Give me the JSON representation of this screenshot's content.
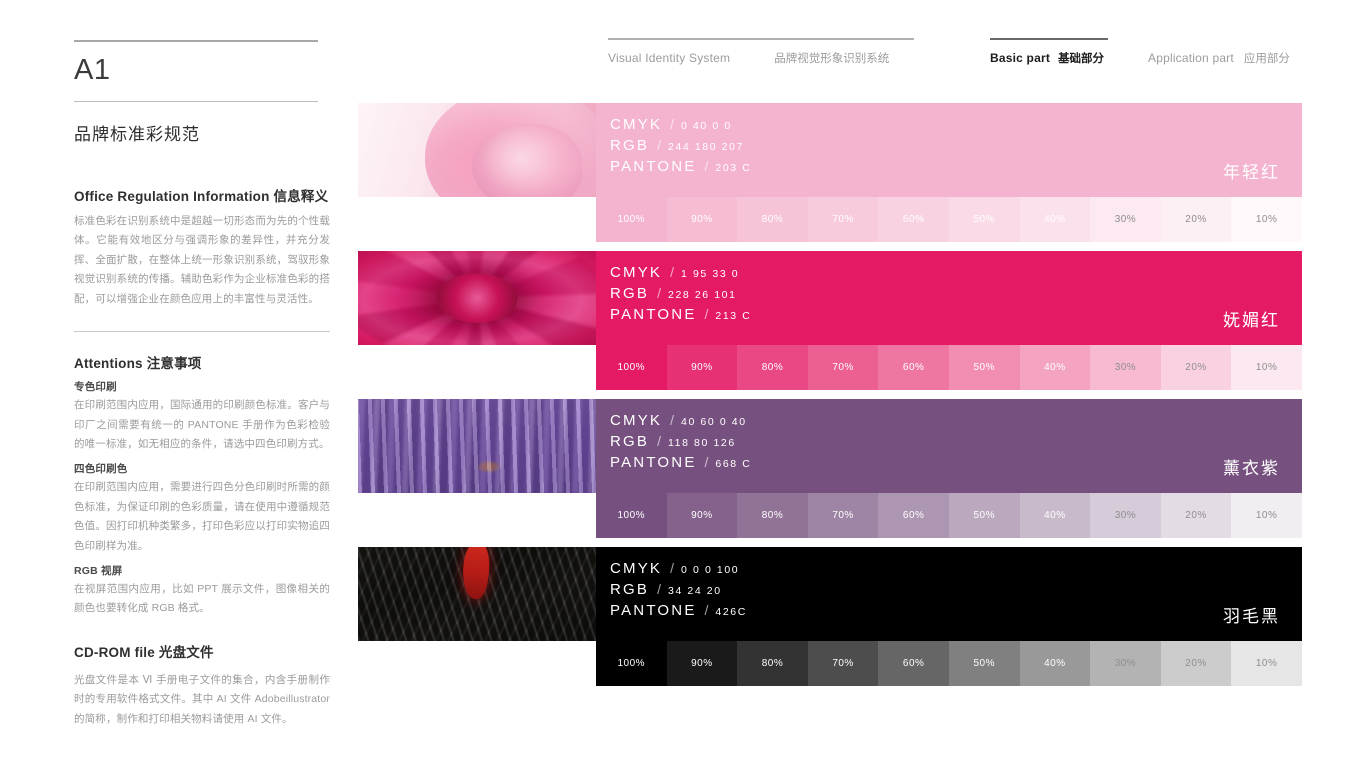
{
  "sidebar": {
    "code": "A1",
    "title_cn": "品牌标准彩规范",
    "sections": [
      {
        "heading_en": "Office Regulation Information",
        "heading_cn": "信息释义",
        "paragraphs": [
          "标准色彩在识别系统中是超越一切形态而为先的个性载体。它能有效地区分与强调形象的差异性，并充分发挥、全面扩散，在整体上统一形象识别系统，驾驭形象视觉识别系统的传播。辅助色彩作为企业标准色彩的搭配，可以增强企业在颜色应用上的丰富性与灵活性。"
        ],
        "subsections": []
      },
      {
        "heading_en": "Attentions",
        "heading_cn": "注意事项",
        "paragraphs": [],
        "subsections": [
          {
            "label": "专色印刷",
            "body": "在印刷范围内应用，国际通用的印刷颜色标准。客户与印厂之间需要有统一的 PANTONE 手册作为色彩检验的唯一标准，如无相应的条件，请选中四色印刷方式。"
          },
          {
            "label": "四色印刷色",
            "body": "在印刷范围内应用，需要进行四色分色印刷时所需的颜色标准，为保证印刷的色彩质量，请在使用中遵循规范色值。因打印机种类繁多，打印色彩应以打印实物追四色印刷样为准。"
          },
          {
            "label": "RGB 视屏",
            "body": "在视屏范围内应用，比如 PPT 展示文件，图像相关的颜色也要转化成 RGB 格式。"
          }
        ]
      },
      {
        "heading_en": "CD-ROM file",
        "heading_cn": "光盘文件",
        "paragraphs": [
          "光盘文件是本 Ⅵ 手册电子文件的集合，内含手册制作时的专用软件格式文件。其中 AI 文件 Adobeillustrator 的简称，制作和打印相关物料请使用 AI 文件。"
        ],
        "subsections": []
      }
    ]
  },
  "nav": {
    "system_en": "Visual Identity System",
    "system_cn": "品牌视觉形象识别系统",
    "basic_en": "Basic part",
    "basic_cn": "基础部分",
    "application_en": "Application part",
    "application_cn": "应用部分"
  },
  "labels": {
    "cmyk": "CMYK",
    "rgb": "RGB",
    "pantone": "PANTONE",
    "slash": "/"
  },
  "tint_steps": [
    "100%",
    "90%",
    "80%",
    "70%",
    "60%",
    "50%",
    "40%",
    "30%",
    "20%",
    "10%"
  ],
  "colors": [
    {
      "name_cn": "年轻红",
      "cmyk": "0  40  0  0",
      "rgb": "244  180  207",
      "pantone": "203 C",
      "hex": "#F4B4CF",
      "thumb": "rose-pale-photo",
      "text_on_swatch": "#FFFFFF",
      "tint_text_light_count": 7
    },
    {
      "name_cn": "妩媚红",
      "cmyk": "1  95  33  0",
      "rgb": "228  26  101",
      "pantone": "213 C",
      "hex": "#E41A65",
      "thumb": "rose-magenta-photo",
      "text_on_swatch": "#FFFFFF",
      "tint_text_light_count": 7
    },
    {
      "name_cn": "薰衣紫",
      "cmyk": "40  60  0  40",
      "rgb": "118  80  126",
      "pantone": "668 C",
      "hex": "#76507E",
      "thumb": "lavender-field-photo",
      "text_on_swatch": "#FFFFFF",
      "tint_text_light_count": 7
    },
    {
      "name_cn": "羽毛黑",
      "cmyk": "0  0  0  100",
      "rgb": "34  24  20",
      "pantone": "426C",
      "hex": "#000000",
      "thumb": "black-rooster-feather-photo",
      "text_on_swatch": "#FFFFFF",
      "tint_text_light_count": 7
    }
  ]
}
